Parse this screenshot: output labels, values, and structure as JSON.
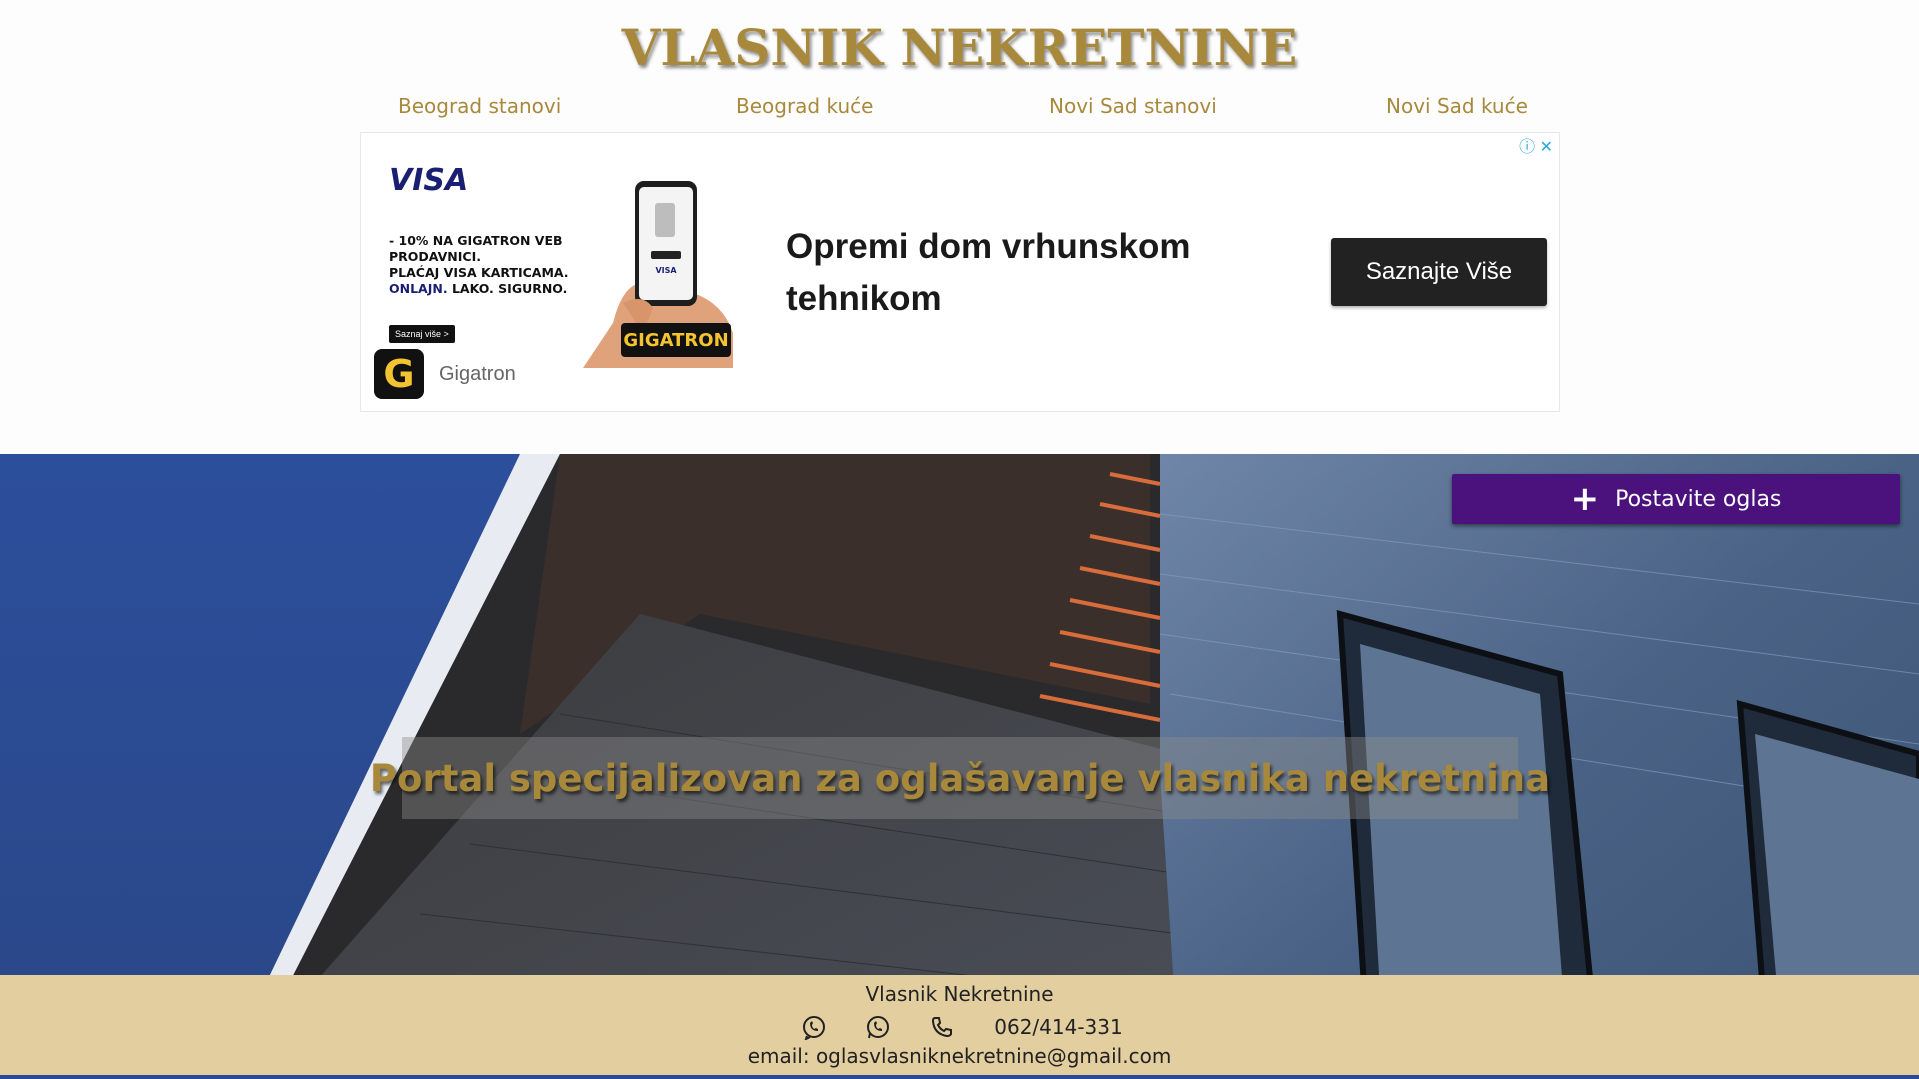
{
  "header": {
    "title": "VLASNIK NEKRETNINE",
    "nav": [
      {
        "label": "Beograd stanovi"
      },
      {
        "label": "Beograd kuće"
      },
      {
        "label": "Novi Sad stanovi"
      },
      {
        "label": "Novi Sad kuće"
      }
    ]
  },
  "ad": {
    "visa_logo": "VISA",
    "promo_line1": "- 10% NA GIGATRON VEB PRODAVNICI.",
    "promo_line2": "PLAĆAJ VISA KARTICAMA.",
    "promo_line3_blue": "ONLAJN.",
    "promo_line3_rest": " LAKO. SIGURNO.",
    "small_button": "Saznaj više >",
    "gigatron_badge": "GIGATRON",
    "headline": "Opremi dom vrhunskom tehnikom",
    "cta": "Saznajte Više",
    "brand_letter": "G",
    "brand_name": "Gigatron"
  },
  "hero": {
    "post_button": "Postavite oglas",
    "tagline": "Portal specijalizovan za oglašavanje vlasnika nekretnina"
  },
  "footer": {
    "name": "Vlasnik Nekretnine",
    "phone": "062/414-331",
    "email": "email: oglasvlasniknekretnine@gmail.com"
  },
  "colors": {
    "gold": "#a8893c",
    "purple": "#4b127d",
    "footer_bg": "#e3cea0",
    "sky": "#2a4c96"
  },
  "icons": [
    "viber-icon",
    "whatsapp-icon",
    "phone-icon",
    "plus-icon",
    "adchoices-icon",
    "close-icon"
  ]
}
